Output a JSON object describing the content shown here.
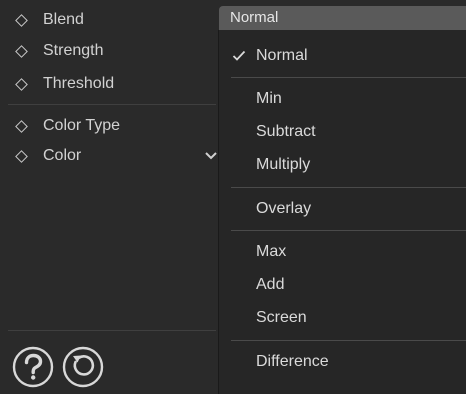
{
  "parameters": [
    {
      "label": "Blend"
    },
    {
      "label": "Strength"
    },
    {
      "label": "Threshold"
    },
    {
      "label": "Color Type"
    },
    {
      "label": "Color"
    }
  ],
  "dropdown": {
    "selected": "Normal",
    "options": [
      {
        "label": "Normal",
        "checked": true
      },
      {
        "label": "Min"
      },
      {
        "label": "Subtract"
      },
      {
        "label": "Multiply"
      },
      {
        "label": "Overlay"
      },
      {
        "label": "Max"
      },
      {
        "label": "Add"
      },
      {
        "label": "Screen"
      },
      {
        "label": "Difference"
      }
    ]
  },
  "icons": {
    "param": "keyframe-diamond-icon",
    "color_expand": "chevron-down-icon",
    "help": "help-icon",
    "reset": "reset-icon",
    "check": "checkmark-icon"
  },
  "colors": {
    "panel_bg": "#2a2a2a",
    "menu_bg": "#262626",
    "combo_bg": "#5a5a5a",
    "text": "#d2d2d2"
  }
}
